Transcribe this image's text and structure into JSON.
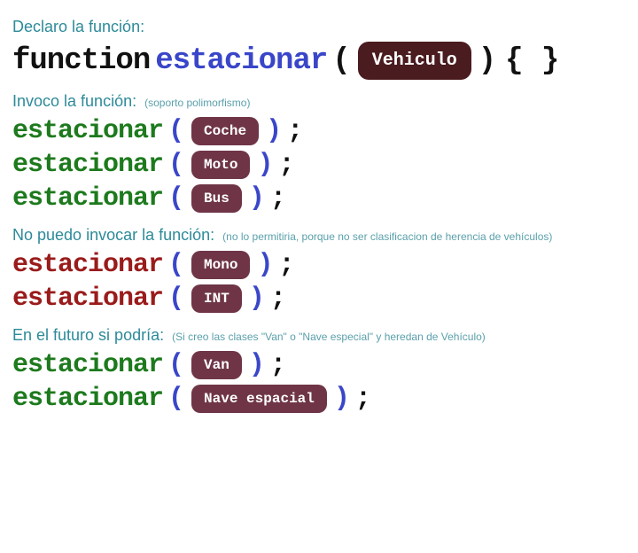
{
  "sections": {
    "declare": {
      "title": "Declaro la función:"
    },
    "invoke": {
      "title": "Invoco la función:",
      "sub": "(soporto polimorfismo)"
    },
    "cannot": {
      "title": "No puedo invocar la función:",
      "sub": "(no lo permitiria, porque no ser clasificacion de herencia de vehículos)"
    },
    "future": {
      "title": "En el futuro si podría:",
      "sub": "(Si creo las clases \"Van\" o \"Nave especial\" y heredan de Vehículo)"
    }
  },
  "declaration": {
    "keyword": "function",
    "name": "estacionar",
    "param_type": "Vehiculo",
    "body": "{ }"
  },
  "punct": {
    "open": "(",
    "close": ")",
    "semi": ";"
  },
  "calls_ok": [
    {
      "fn": "estacionar",
      "arg": "Coche"
    },
    {
      "fn": "estacionar",
      "arg": "Moto"
    },
    {
      "fn": "estacionar",
      "arg": "Bus"
    }
  ],
  "calls_bad": [
    {
      "fn": "estacionar",
      "arg": "Mono"
    },
    {
      "fn": "estacionar",
      "arg": "INT"
    }
  ],
  "calls_future": [
    {
      "fn": "estacionar",
      "arg": "Van"
    },
    {
      "fn": "estacionar",
      "arg": "Nave espacial"
    }
  ]
}
